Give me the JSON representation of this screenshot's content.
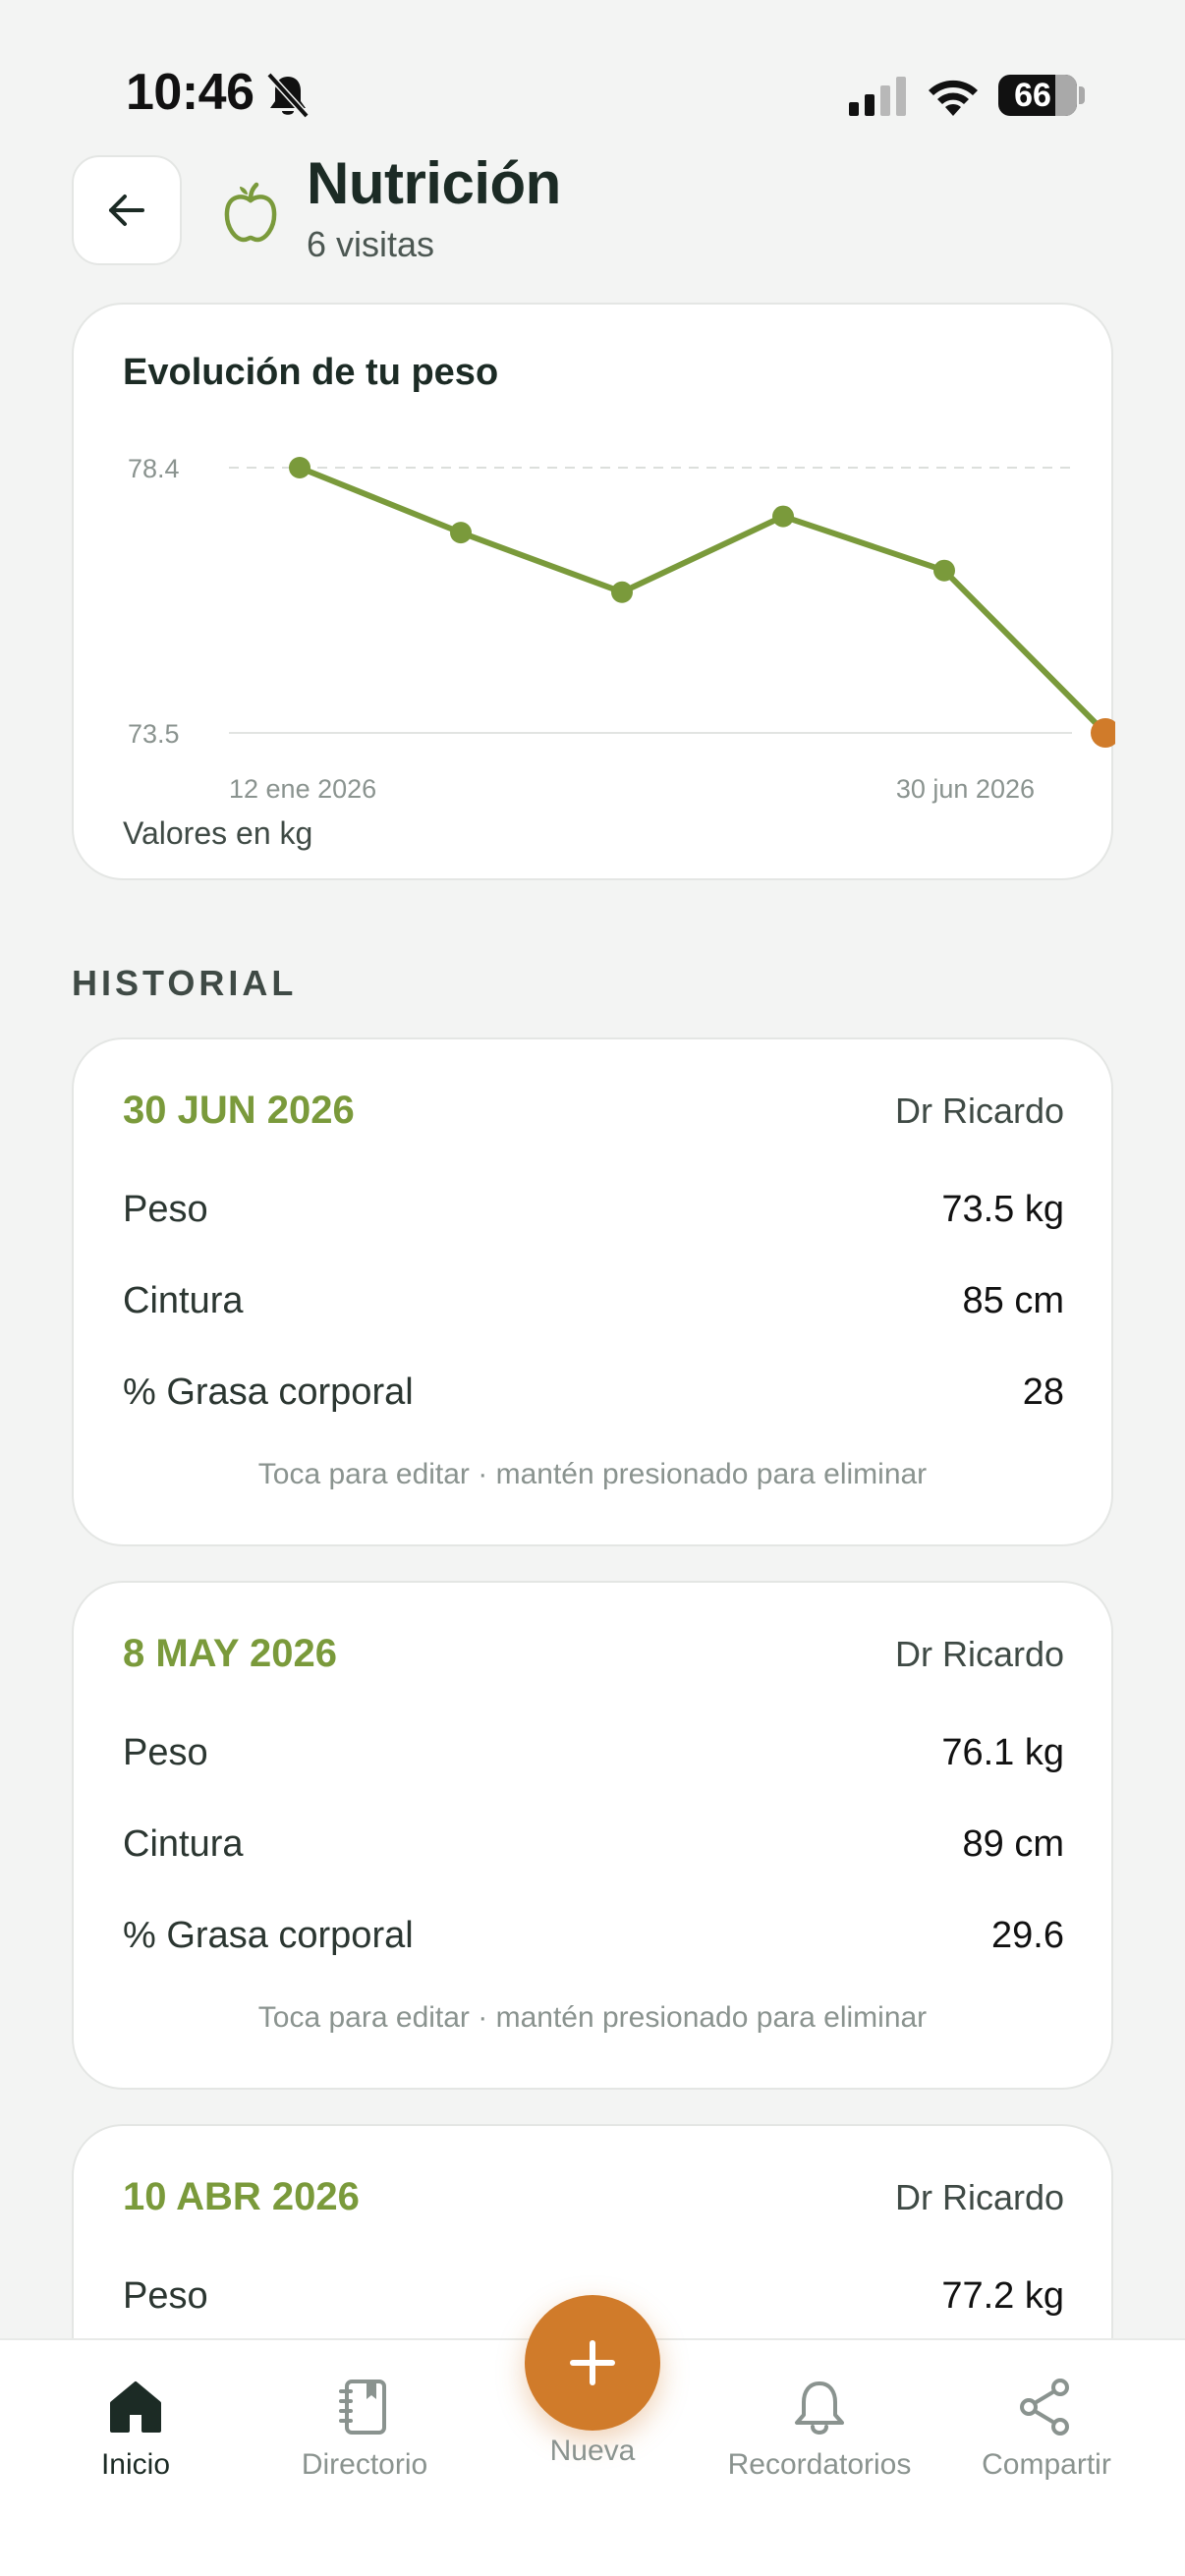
{
  "status_bar": {
    "time": "10:46",
    "battery": "66"
  },
  "header": {
    "title": "Nutrición",
    "subtitle": "6 visitas"
  },
  "chart_card": {
    "title": "Evolución de tu peso",
    "note": "Valores en kg",
    "y_top_label": "78.4",
    "y_bottom_label": "73.5",
    "x_start_label": "12 ene 2026",
    "x_end_label": "30 jun 2026"
  },
  "chart_data": {
    "type": "line",
    "title": "Evolución de tu peso",
    "xlabel": "",
    "ylabel": "",
    "ylim": [
      73.5,
      78.4
    ],
    "x_tick_labels": [
      "12 ene 2026",
      "30 jun 2026"
    ],
    "y_tick_labels": [
      "78.4",
      "73.5"
    ],
    "series": [
      {
        "values": [
          78.4,
          77.2,
          76.1,
          77.5,
          76.5,
          73.5
        ]
      }
    ],
    "grid": false,
    "colors": {
      "line": "#7a9a3b",
      "last_point": "#d07b2a"
    }
  },
  "section": {
    "label": "HISTORIAL"
  },
  "visits": [
    {
      "date": "30 JUN 2026",
      "doctor": "Dr Ricardo",
      "rows": [
        {
          "label": "Peso",
          "value": "73.5 kg"
        },
        {
          "label": "Cintura",
          "value": "85 cm"
        },
        {
          "label": "% Grasa corporal",
          "value": "28"
        }
      ],
      "hint": "Toca para editar · mantén presionado para eliminar"
    },
    {
      "date": "8 MAY 2026",
      "doctor": "Dr Ricardo",
      "rows": [
        {
          "label": "Peso",
          "value": "76.1 kg"
        },
        {
          "label": "Cintura",
          "value": "89 cm"
        },
        {
          "label": "% Grasa corporal",
          "value": "29.6"
        }
      ],
      "hint": "Toca para editar · mantén presionado para eliminar"
    },
    {
      "date": "10 ABR 2026",
      "doctor": "Dr Ricardo",
      "rows": [
        {
          "label": "Peso",
          "value": "77.2 kg"
        }
      ]
    }
  ],
  "nav": {
    "home": "Inicio",
    "directory": "Directorio",
    "new": "Nueva",
    "reminders": "Recordatorios",
    "share": "Compartir"
  },
  "colors": {
    "accent": "#7a9a3b",
    "fab": "#d07b2a",
    "background": "#f3f4f3"
  }
}
